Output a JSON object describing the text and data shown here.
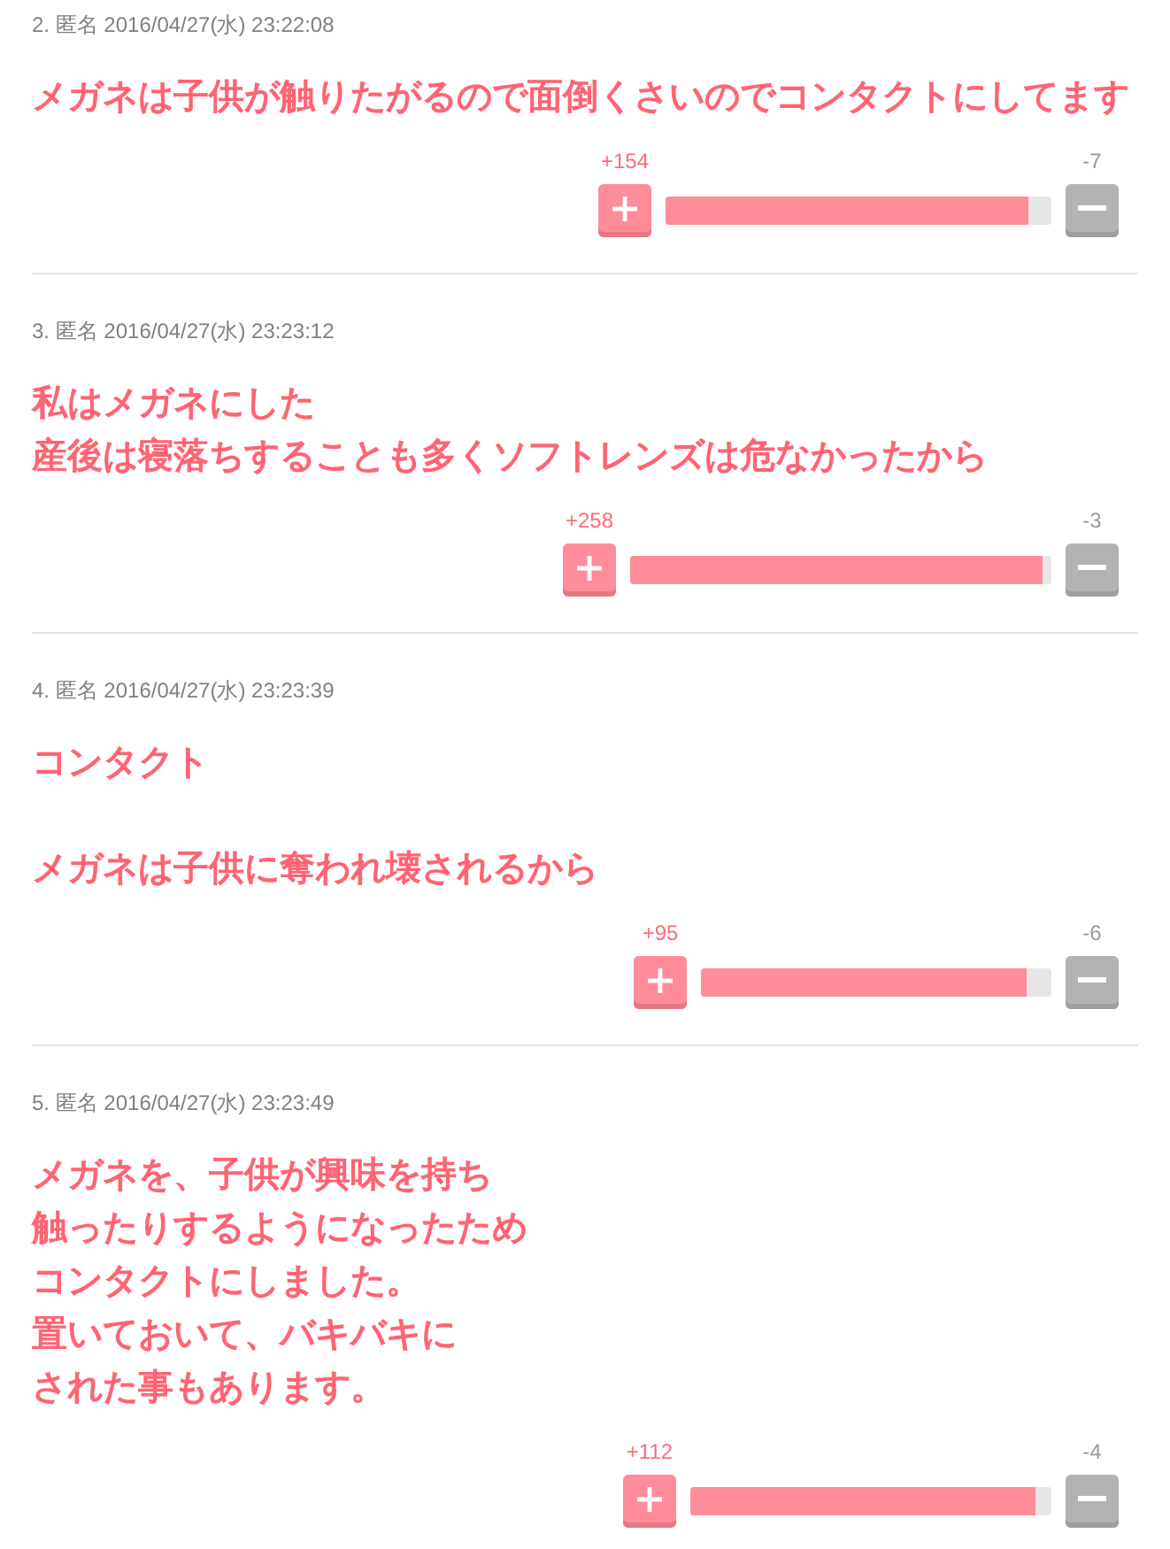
{
  "comments": [
    {
      "meta": "2. 匿名 2016/04/27(水) 23:22:08",
      "paragraphs": [
        [
          "メガネは子供が触りたがるので面倒くさいのでコンタクトにしてます"
        ]
      ],
      "votes": {
        "plus": "+154",
        "minus": "-7",
        "level": 0.94
      }
    },
    {
      "meta": "3. 匿名 2016/04/27(水) 23:23:12",
      "paragraphs": [
        [
          "私はメガネにした",
          "産後は寝落ちすることも多くソフトレンズは危なかったから"
        ]
      ],
      "votes": {
        "plus": "+258",
        "minus": "-3",
        "level": 0.98
      }
    },
    {
      "meta": "4. 匿名 2016/04/27(水) 23:23:39",
      "paragraphs": [
        [
          "コンタクト"
        ],
        [
          "メガネは子供に奪われ壊されるから"
        ]
      ],
      "votes": {
        "plus": "+95",
        "minus": "-6",
        "level": 0.93
      }
    },
    {
      "meta": "5. 匿名 2016/04/27(水) 23:23:49",
      "paragraphs": [
        [
          "メガネを、子供が興味を持ち",
          "触ったりするようになったため",
          "コンタクトにしました。",
          "置いておいて、バキバキに",
          "された事もあります。"
        ]
      ],
      "votes": {
        "plus": "+112",
        "minus": "-4",
        "level": 0.955
      }
    }
  ]
}
